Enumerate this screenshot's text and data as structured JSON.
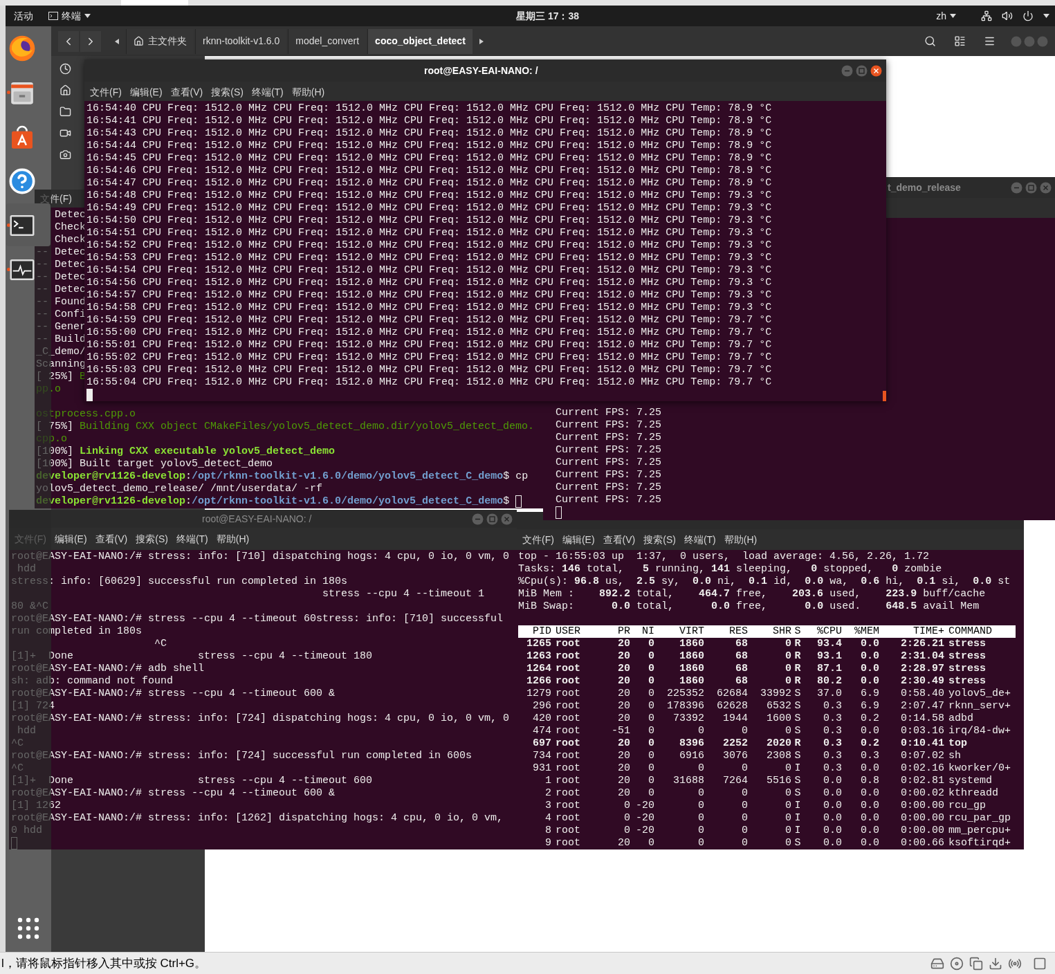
{
  "top_bar": {
    "activities": "活动",
    "app_menu": "终端",
    "clock": "星期三 17：38",
    "language": "zh"
  },
  "dock": {
    "items": [
      {
        "kind": "browser",
        "running": false,
        "selected": false
      },
      {
        "kind": "files",
        "running": true,
        "selected": false
      },
      {
        "kind": "software",
        "running": false,
        "selected": false
      },
      {
        "kind": "help",
        "running": false,
        "selected": false
      },
      {
        "kind": "terminal",
        "running": true,
        "selected": true
      },
      {
        "kind": "monitor",
        "running": true,
        "selected": false
      }
    ]
  },
  "file_manager": {
    "breadcrumbs": [
      {
        "label": "主文件夹",
        "kind": "home",
        "selected": false
      },
      {
        "label": "rknn-toolkit-v1.6.0",
        "kind": "folder",
        "selected": false
      },
      {
        "label": "model_convert",
        "kind": "folder",
        "selected": false
      },
      {
        "label": "coco_object_detect",
        "kind": "folder",
        "selected": true
      }
    ]
  },
  "build_terminal": {
    "menu": [
      "文件(F)"
    ],
    "upper_lines": [
      [
        {
          "text": "   Detec",
          "kind": "plain"
        }
      ],
      [
        {
          "text": "   Check",
          "kind": "plain"
        }
      ],
      [
        {
          "text": "   Check",
          "kind": "plain"
        }
      ],
      [
        {
          "text": "-- Detec",
          "kind": "plain"
        }
      ],
      [
        {
          "text": "-- Detec",
          "kind": "plain"
        }
      ],
      [
        {
          "text": "-- Detec",
          "kind": "plain"
        }
      ],
      [
        {
          "text": "-- Detec",
          "kind": "plain"
        }
      ],
      [
        {
          "text": "-- Found",
          "kind": "plain"
        }
      ],
      [
        {
          "text": "-- Confi",
          "kind": "plain"
        }
      ],
      [
        {
          "text": "-- Gener",
          "kind": "plain"
        }
      ],
      [
        {
          "text": "-- Build",
          "kind": "plain"
        }
      ],
      [
        {
          "text": "_C_demo/",
          "kind": "plain"
        }
      ],
      [
        {
          "text": "Scanning",
          "kind": "plain"
        }
      ],
      [
        {
          "text": "[ 25%] ",
          "kind": "plain"
        },
        {
          "text": "B",
          "kind": "green"
        }
      ],
      [
        {
          "text": "pp.o",
          "kind": "green"
        }
      ]
    ],
    "lower_lines": [
      [
        {
          "text": "ostprocess.cpp.o",
          "kind": "green"
        }
      ],
      [
        {
          "text": "[ 75%] ",
          "kind": "plain"
        },
        {
          "text": "Building CXX object CMakeFiles/yolov5_detect_demo.dir/yolov5_detect_demo.",
          "kind": "green"
        }
      ],
      [
        {
          "text": "cpp.o",
          "kind": "green"
        }
      ],
      [
        {
          "text": "[100%] ",
          "kind": "plain"
        },
        {
          "text": "Linking CXX executable yolov5_detect_demo",
          "kind": "greenbold"
        }
      ],
      [
        {
          "text": "[100%] Built target yolov5_detect_demo",
          "kind": "plain"
        }
      ],
      [
        {
          "text": "developer@rv1126-develop",
          "kind": "greenbold"
        },
        {
          "text": ":",
          "kind": "plain"
        },
        {
          "text": "/opt/rknn-toolkit-v1.6.0/demo/yolov5_detect_C_demo",
          "kind": "bluebold"
        },
        {
          "text": "$ cp",
          "kind": "plain"
        }
      ],
      [
        {
          "text": "yolov5_detect_demo_release/ /mnt/userdata/ -rf",
          "kind": "plain"
        }
      ],
      [
        {
          "text": "developer@rv1126-develop",
          "kind": "greenbold"
        },
        {
          "text": ":",
          "kind": "plain"
        },
        {
          "text": "/opt/rknn-toolkit-v1.6.0/demo/yolov5_detect_C_demo",
          "kind": "bluebold"
        },
        {
          "text": "$",
          "kind": "plain"
        }
      ]
    ]
  },
  "fps_terminal": {
    "title": "t_demo_release",
    "active": false,
    "lines": [
      "Current FPS: 7.25",
      "Current FPS: 7.25",
      "Current FPS: 7.25",
      "Current FPS: 7.25",
      "Current FPS: 7.25",
      "Current FPS: 7.25",
      "Current FPS: 7.25",
      "Current FPS: 7.25"
    ]
  },
  "freq_terminal": {
    "title": "root@EASY-EAI-NANO: /",
    "active": true,
    "menu": [
      "文件(F)",
      "编辑(E)",
      "查看(V)",
      "搜索(S)",
      "终端(T)",
      "帮助(H)"
    ],
    "lines": [
      "16:54:40 CPU Freq: 1512.0 MHz CPU Freq: 1512.0 MHz CPU Freq: 1512.0 MHz CPU Freq: 1512.0 MHz CPU Temp: 78.9 °C",
      "16:54:41 CPU Freq: 1512.0 MHz CPU Freq: 1512.0 MHz CPU Freq: 1512.0 MHz CPU Freq: 1512.0 MHz CPU Temp: 78.9 °C",
      "16:54:43 CPU Freq: 1512.0 MHz CPU Freq: 1512.0 MHz CPU Freq: 1512.0 MHz CPU Freq: 1512.0 MHz CPU Temp: 78.9 °C",
      "16:54:44 CPU Freq: 1512.0 MHz CPU Freq: 1512.0 MHz CPU Freq: 1512.0 MHz CPU Freq: 1512.0 MHz CPU Temp: 78.9 °C",
      "16:54:45 CPU Freq: 1512.0 MHz CPU Freq: 1512.0 MHz CPU Freq: 1512.0 MHz CPU Freq: 1512.0 MHz CPU Temp: 78.9 °C",
      "16:54:46 CPU Freq: 1512.0 MHz CPU Freq: 1512.0 MHz CPU Freq: 1512.0 MHz CPU Freq: 1512.0 MHz CPU Temp: 78.9 °C",
      "16:54:47 CPU Freq: 1512.0 MHz CPU Freq: 1512.0 MHz CPU Freq: 1512.0 MHz CPU Freq: 1512.0 MHz CPU Temp: 78.9 °C",
      "16:54:48 CPU Freq: 1512.0 MHz CPU Freq: 1512.0 MHz CPU Freq: 1512.0 MHz CPU Freq: 1512.0 MHz CPU Temp: 79.3 °C",
      "16:54:49 CPU Freq: 1512.0 MHz CPU Freq: 1512.0 MHz CPU Freq: 1512.0 MHz CPU Freq: 1512.0 MHz CPU Temp: 79.3 °C",
      "16:54:50 CPU Freq: 1512.0 MHz CPU Freq: 1512.0 MHz CPU Freq: 1512.0 MHz CPU Freq: 1512.0 MHz CPU Temp: 79.3 °C",
      "16:54:51 CPU Freq: 1512.0 MHz CPU Freq: 1512.0 MHz CPU Freq: 1512.0 MHz CPU Freq: 1512.0 MHz CPU Temp: 79.3 °C",
      "16:54:52 CPU Freq: 1512.0 MHz CPU Freq: 1512.0 MHz CPU Freq: 1512.0 MHz CPU Freq: 1512.0 MHz CPU Temp: 79.3 °C",
      "16:54:53 CPU Freq: 1512.0 MHz CPU Freq: 1512.0 MHz CPU Freq: 1512.0 MHz CPU Freq: 1512.0 MHz CPU Temp: 79.3 °C",
      "16:54:54 CPU Freq: 1512.0 MHz CPU Freq: 1512.0 MHz CPU Freq: 1512.0 MHz CPU Freq: 1512.0 MHz CPU Temp: 79.3 °C",
      "16:54:56 CPU Freq: 1512.0 MHz CPU Freq: 1512.0 MHz CPU Freq: 1512.0 MHz CPU Freq: 1512.0 MHz CPU Temp: 79.3 °C",
      "16:54:57 CPU Freq: 1512.0 MHz CPU Freq: 1512.0 MHz CPU Freq: 1512.0 MHz CPU Freq: 1512.0 MHz CPU Temp: 79.3 °C",
      "16:54:58 CPU Freq: 1512.0 MHz CPU Freq: 1512.0 MHz CPU Freq: 1512.0 MHz CPU Freq: 1512.0 MHz CPU Temp: 79.3 °C",
      "16:54:59 CPU Freq: 1512.0 MHz CPU Freq: 1512.0 MHz CPU Freq: 1512.0 MHz CPU Freq: 1512.0 MHz CPU Temp: 79.7 °C",
      "16:55:00 CPU Freq: 1512.0 MHz CPU Freq: 1512.0 MHz CPU Freq: 1512.0 MHz CPU Freq: 1512.0 MHz CPU Temp: 79.7 °C",
      "16:55:01 CPU Freq: 1512.0 MHz CPU Freq: 1512.0 MHz CPU Freq: 1512.0 MHz CPU Freq: 1512.0 MHz CPU Temp: 79.7 °C",
      "16:55:02 CPU Freq: 1512.0 MHz CPU Freq: 1512.0 MHz CPU Freq: 1512.0 MHz CPU Freq: 1512.0 MHz CPU Temp: 79.7 °C",
      "16:55:03 CPU Freq: 1512.0 MHz CPU Freq: 1512.0 MHz CPU Freq: 1512.0 MHz CPU Freq: 1512.0 MHz CPU Temp: 79.7 °C",
      "16:55:04 CPU Freq: 1512.0 MHz CPU Freq: 1512.0 MHz CPU Freq: 1512.0 MHz CPU Freq: 1512.0 MHz CPU Temp: 79.7 °C"
    ]
  },
  "stress_terminal": {
    "title": "root@EASY-EAI-NANO: /",
    "active": false,
    "menu": [
      "文件(F)",
      "编辑(E)",
      "查看(V)",
      "搜索(S)",
      "终端(T)",
      "帮助(H)"
    ],
    "lines": [
      "root@EASY-EAI-NANO:/# stress: info: [710] dispatching hogs: 4 cpu, 0 io, 0 vm, 0",
      " hdd",
      "stress: info: [60629] successful run completed in 180s",
      "                                                  stress --cpu 4 --timeout 1",
      "80 &^C",
      "root@EASY-EAI-NANO:/# stress --cpu 4 --timeout 60stress: info: [710] successful",
      "run completed in 180s",
      "                       ^C",
      "[1]+  Done                    stress --cpu 4 --timeout 180",
      "root@EASY-EAI-NANO:/# adb shell",
      "sh: adb: command not found",
      "root@EASY-EAI-NANO:/# stress --cpu 4 --timeout 600 &",
      "[1] 724",
      "root@EASY-EAI-NANO:/# stress: info: [724] dispatching hogs: 4 cpu, 0 io, 0 vm, 0",
      " hdd",
      "^C",
      "root@EASY-EAI-NANO:/# stress: info: [724] successful run completed in 600s",
      "^C",
      "[1]+  Done                    stress --cpu 4 --timeout 600",
      "root@EASY-EAI-NANO:/# stress --cpu 4 --timeout 600 &",
      "[1] 1262",
      "root@EASY-EAI-NANO:/# stress: info: [1262] dispatching hogs: 4 cpu, 0 io, 0 vm,",
      "0 hdd"
    ]
  },
  "top_terminal": {
    "menu": [
      "文件(F)",
      "编辑(E)",
      "查看(V)",
      "搜索(S)",
      "终端(T)",
      "帮助(H)"
    ],
    "summary": [
      "top - 16:55:03 up  1:37,  0 users,  load average: 4.56, 2.26, 1.72",
      "Tasks: **146** total,   **5** running, **141** sleeping,   **0** stopped,   **0** zombie",
      "%Cpu(s): **96.8** us,  **2.5** sy,  **0.0** ni,  **0.1** id,  **0.0** wa,  **0.6** hi,  **0.1** si,  **0.0** st",
      "MiB Mem :    **892.2** total,    **464.7** free,    **203.6** used,    **223.9** buff/cache",
      "MiB Swap:      **0.0** total,      **0.0** free,      **0.0** used.    **648.5** avail Mem"
    ],
    "table": {
      "columns": [
        "PID",
        "USER",
        "PR",
        "NI",
        "VIRT",
        "RES",
        "SHR",
        "S",
        "%CPU",
        "%MEM",
        "TIME+",
        "COMMAND"
      ],
      "rows": [
        {
          "bold": true,
          "cells": [
            "1265",
            "root",
            "20",
            "0",
            "1860",
            "68",
            "0",
            "R",
            "93.4",
            "0.0",
            "2:26.21",
            "stress"
          ]
        },
        {
          "bold": true,
          "cells": [
            "1263",
            "root",
            "20",
            "0",
            "1860",
            "68",
            "0",
            "R",
            "93.1",
            "0.0",
            "2:31.04",
            "stress"
          ]
        },
        {
          "bold": true,
          "cells": [
            "1264",
            "root",
            "20",
            "0",
            "1860",
            "68",
            "0",
            "R",
            "87.1",
            "0.0",
            "2:28.97",
            "stress"
          ]
        },
        {
          "bold": true,
          "cells": [
            "1266",
            "root",
            "20",
            "0",
            "1860",
            "68",
            "0",
            "R",
            "80.2",
            "0.0",
            "2:30.49",
            "stress"
          ]
        },
        {
          "bold": false,
          "cells": [
            "1279",
            "root",
            "20",
            "0",
            "225352",
            "62684",
            "33992",
            "S",
            "37.0",
            "6.9",
            "0:58.40",
            "yolov5_de+"
          ]
        },
        {
          "bold": false,
          "cells": [
            "296",
            "root",
            "20",
            "0",
            "178396",
            "62628",
            "6532",
            "S",
            "0.3",
            "6.9",
            "2:07.47",
            "rknn_serv+"
          ]
        },
        {
          "bold": false,
          "cells": [
            "420",
            "root",
            "20",
            "0",
            "73392",
            "1944",
            "1600",
            "S",
            "0.3",
            "0.2",
            "0:14.58",
            "adbd"
          ]
        },
        {
          "bold": false,
          "cells": [
            "474",
            "root",
            "-51",
            "0",
            "0",
            "0",
            "0",
            "S",
            "0.3",
            "0.0",
            "0:03.16",
            "irq/84-dw+"
          ]
        },
        {
          "bold": true,
          "cells": [
            "697",
            "root",
            "20",
            "0",
            "8396",
            "2252",
            "2020",
            "R",
            "0.3",
            "0.2",
            "0:10.41",
            "top"
          ]
        },
        {
          "bold": false,
          "cells": [
            "734",
            "root",
            "20",
            "0",
            "6916",
            "3076",
            "2308",
            "S",
            "0.3",
            "0.3",
            "0:07.02",
            "sh"
          ]
        },
        {
          "bold": false,
          "cells": [
            "931",
            "root",
            "20",
            "0",
            "0",
            "0",
            "0",
            "I",
            "0.3",
            "0.0",
            "0:02.16",
            "kworker/0+"
          ]
        },
        {
          "bold": false,
          "cells": [
            "1",
            "root",
            "20",
            "0",
            "31688",
            "7264",
            "5516",
            "S",
            "0.0",
            "0.8",
            "0:02.81",
            "systemd"
          ]
        },
        {
          "bold": false,
          "cells": [
            "2",
            "root",
            "20",
            "0",
            "0",
            "0",
            "0",
            "S",
            "0.0",
            "0.0",
            "0:00.02",
            "kthreadd"
          ]
        },
        {
          "bold": false,
          "cells": [
            "3",
            "root",
            "0",
            "-20",
            "0",
            "0",
            "0",
            "I",
            "0.0",
            "0.0",
            "0:00.00",
            "rcu_gp"
          ]
        },
        {
          "bold": false,
          "cells": [
            "4",
            "root",
            "0",
            "-20",
            "0",
            "0",
            "0",
            "I",
            "0.0",
            "0.0",
            "0:00.00",
            "rcu_par_gp"
          ]
        },
        {
          "bold": false,
          "cells": [
            "8",
            "root",
            "0",
            "-20",
            "0",
            "0",
            "0",
            "I",
            "0.0",
            "0.0",
            "0:00.00",
            "mm_percpu+"
          ]
        },
        {
          "bold": false,
          "cells": [
            "9",
            "root",
            "20",
            "0",
            "0",
            "0",
            "0",
            "S",
            "0.0",
            "0.0",
            "0:00.66",
            "ksoftirqd+"
          ]
        }
      ]
    }
  },
  "status_bar": {
    "message": "l，请将鼠标指针移入其中或按 Ctrl+G。"
  }
}
